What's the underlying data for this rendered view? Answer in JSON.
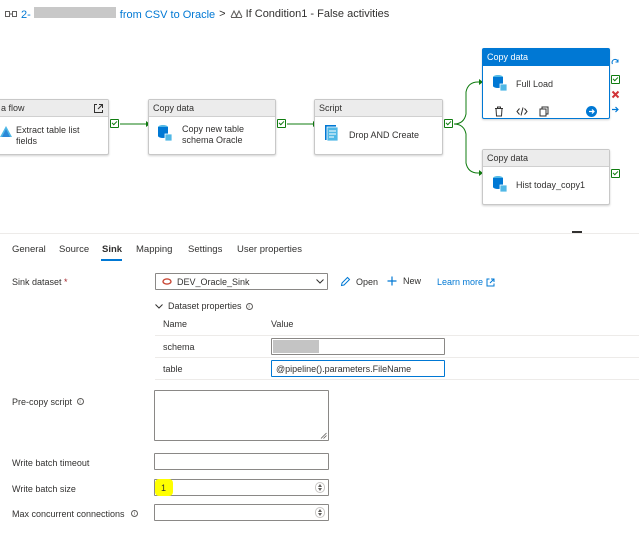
{
  "breadcrumb": {
    "pipeline_prefix": "2-",
    "pipeline_suffix": "from CSV to Oracle",
    "separator": ">",
    "current": "If Condition1 - False activities"
  },
  "canvas": {
    "nodes": [
      {
        "header": "a flow",
        "label_1": "Extract table list",
        "label_2": "fields"
      },
      {
        "header": "Copy data",
        "label_1": "Copy new table",
        "label_2": "schema Oracle"
      },
      {
        "header": "Script",
        "label_1": "Drop AND Create"
      },
      {
        "header": "Copy data",
        "label_1": "Full Load"
      },
      {
        "header": "Copy data",
        "label_1": "Hist today_copy1"
      }
    ]
  },
  "tabs": [
    "General",
    "Source",
    "Sink",
    "Mapping",
    "Settings",
    "User properties"
  ],
  "active_tab": "Sink",
  "sink": {
    "dataset_label": "Sink dataset",
    "required_mark": "*",
    "dataset_value": "DEV_Oracle_Sink",
    "open_label": "Open",
    "new_label": "New",
    "learn_more_label": "Learn more",
    "dataset_properties_label": "Dataset properties",
    "columns": {
      "name": "Name",
      "value": "Value"
    },
    "properties": [
      {
        "name": "schema",
        "value": ""
      },
      {
        "name": "table",
        "value": "@pipeline().parameters.FileName"
      }
    ],
    "pre_copy_script_label": "Pre-copy script",
    "pre_copy_script_value": "",
    "write_batch_timeout_label": "Write batch timeout",
    "write_batch_timeout_value": "",
    "write_batch_size_label": "Write batch size",
    "write_batch_size_value": "1",
    "max_connections_label": "Max concurrent connections",
    "max_connections_value": ""
  },
  "colors": {
    "accent": "#0078d4",
    "success": "#107c10",
    "error": "#d13438",
    "highlight": "#ffff00"
  }
}
